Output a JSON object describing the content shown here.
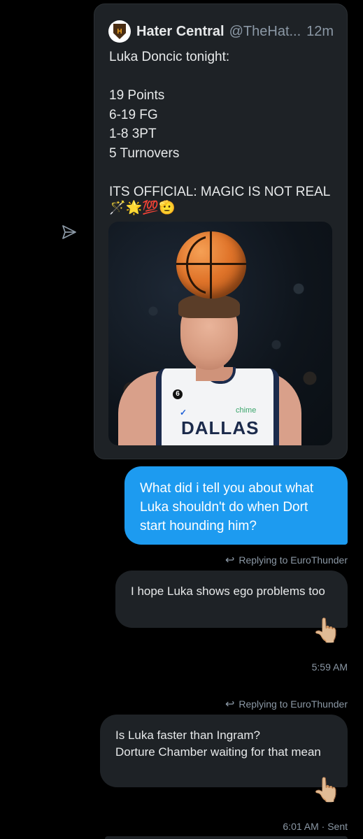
{
  "tweet": {
    "author_name": "Hater Central",
    "handle": "@TheHat...",
    "time": "12m",
    "text_lines": "Luka Doncic tonight:\n\n19 Points\n6-19 FG\n1-8 3PT\n5 Turnovers\n\nITS OFFICIAL: MAGIC IS NOT REAL",
    "emojis": "🪄🌟💯🫡",
    "image_alt": "Luka Doncic with a basketball on his head",
    "image_text": {
      "jersey": "DALLAS",
      "sponsor": "chime",
      "number": "6"
    }
  },
  "messages": [
    {
      "type": "sent",
      "text": "What did i tell you about what Luka shouldn't do when Dort start hounding him?"
    },
    {
      "type": "reply_context",
      "text": "Replying to EuroThunder"
    },
    {
      "type": "received_reply",
      "text": "I hope Luka shows ego problems too",
      "reaction": "👆🏼",
      "timestamp": "5:59 AM"
    },
    {
      "type": "reply_context",
      "text": "Replying to EuroThunder"
    },
    {
      "type": "received_reply",
      "text": "Is Luka faster than Ingram?\nDorture Chamber waiting for that mean",
      "reaction": "👆🏼",
      "timestamp": "6:01 AM · Sent"
    }
  ],
  "icons": {
    "send": "send-icon",
    "reply": "reply-arrow-icon"
  },
  "colors": {
    "background": "#000000",
    "card": "#1e2226",
    "accent_blue": "#1d9bf0",
    "muted": "#8b98a5"
  }
}
